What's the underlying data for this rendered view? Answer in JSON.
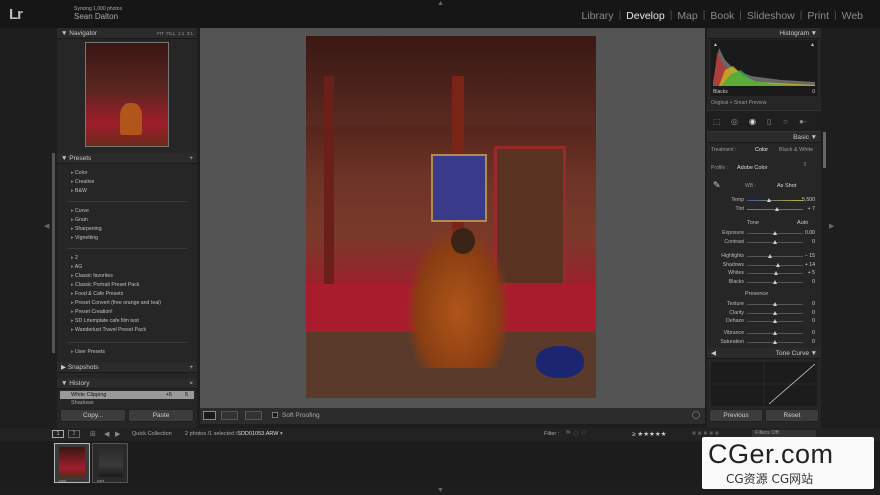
{
  "app": {
    "logo_text": "Lr",
    "sync_status": "Syncing 1,000 photos",
    "user_name": "Sean Dalton"
  },
  "modules": [
    {
      "label": "Library",
      "active": false
    },
    {
      "label": "Develop",
      "active": true
    },
    {
      "label": "Map",
      "active": false
    },
    {
      "label": "Book",
      "active": false
    },
    {
      "label": "Slideshow",
      "active": false
    },
    {
      "label": "Print",
      "active": false
    },
    {
      "label": "Web",
      "active": false
    }
  ],
  "left_panel": {
    "navigator": {
      "title": "Navigator",
      "zoom_options": [
        "FIT",
        "FILL",
        "1:1",
        "3:1"
      ]
    },
    "presets": {
      "title": "Presets",
      "group1": [
        "Color",
        "Creative",
        "B&W"
      ],
      "group2": [
        "Curve",
        "Grain",
        "Sharpening",
        "Vignetting"
      ],
      "group3": [
        "2",
        "AG",
        "Classic favorites",
        "Classic Portrait Preset Pack",
        "Food & Cafe Presets",
        "Preset Convert (free orange and teal)",
        "Preset Creation!",
        "SD Lrtemplate cafe film test",
        "Wanderlust Travel Preset Pack"
      ],
      "group4": [
        "User Presets"
      ]
    },
    "snapshots": {
      "title": "Snapshots"
    },
    "history": {
      "title": "History",
      "active_item": "White Clipping",
      "active_val1": "+5",
      "active_val2": "5",
      "next_item": "Shadows"
    },
    "copy_label": "Copy...",
    "paste_label": "Paste"
  },
  "toolbar": {
    "soft_proofing": "Soft Proofing"
  },
  "right_panel": {
    "histogram": {
      "title": "Histogram",
      "readout": "Blacks",
      "readout_val": "0",
      "preview_info": "Original + Smart Preview"
    },
    "basic": {
      "title": "Basic",
      "treatment_label": "Treatment :",
      "treatment_color": "Color",
      "treatment_bw": "Black & White",
      "profile_label": "Profile :",
      "profile_value": "Adobe Color",
      "wb_label": "WB :",
      "wb_value": "As Shot",
      "tone_label": "Tone",
      "tone_auto": "Auto",
      "presence_label": "Presence",
      "sliders_wb": [
        {
          "label": "Temp",
          "value": "5,500",
          "pos": 0.4
        },
        {
          "label": "Tint",
          "value": "+ 7",
          "pos": 0.55
        }
      ],
      "sliders_tone": [
        {
          "label": "Exposure",
          "value": "0.00",
          "pos": 0.5
        },
        {
          "label": "Contrast",
          "value": "0",
          "pos": 0.5
        }
      ],
      "sliders_tone2": [
        {
          "label": "Highlights",
          "value": "− 15",
          "pos": 0.42
        },
        {
          "label": "Shadows",
          "value": "+ 14",
          "pos": 0.57
        },
        {
          "label": "Whites",
          "value": "+ 5",
          "pos": 0.53
        },
        {
          "label": "Blacks",
          "value": "0",
          "pos": 0.5
        }
      ],
      "sliders_presence": [
        {
          "label": "Texture",
          "value": "0",
          "pos": 0.5
        },
        {
          "label": "Clarity",
          "value": "0",
          "pos": 0.5
        },
        {
          "label": "Dehaze",
          "value": "0",
          "pos": 0.5
        }
      ],
      "sliders_presence2": [
        {
          "label": "Vibrance",
          "value": "0",
          "pos": 0.5
        },
        {
          "label": "Saturation",
          "value": "0",
          "pos": 0.5
        }
      ]
    },
    "tone_curve": {
      "title": "Tone Curve"
    },
    "previous_label": "Previous",
    "reset_label": "Reset"
  },
  "filmstrip": {
    "page1": "1",
    "page2": "2",
    "source": "Quick Collection",
    "count_info": "2 photos /1 selected /",
    "filename": "SDD01053.ARW",
    "filter_label": "Filter :",
    "filter_stars": "≥ ★★★★★",
    "filter_preset": "Filters Off"
  },
  "watermark": {
    "main": "CGer.com",
    "sub": "CG资源 CG网站"
  }
}
